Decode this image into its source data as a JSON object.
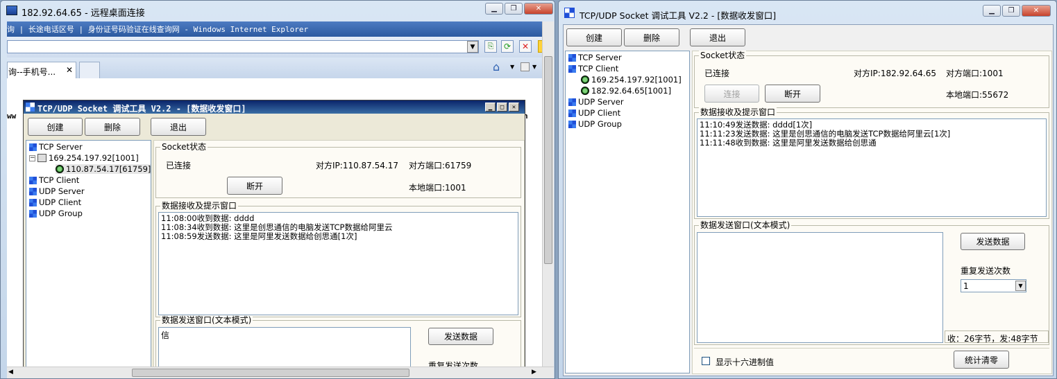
{
  "rdp": {
    "title": "182.92.64.65 - 远程桌面连接",
    "ie_title": "询 | 长途电话区号 | 身份证号码验证在线查询网 - Windows Internet Explorer",
    "ie_tab": "询--手机号...",
    "ie_url_fragment_left": "ww",
    "ie_url_fragment_right": "n"
  },
  "inner_tool": {
    "title": "TCP/UDP Socket 调试工具 V2.2 - [数据收发窗口]",
    "toolbar": {
      "create": "创建",
      "delete": "删除",
      "exit": "退出"
    },
    "tree": {
      "tcp_server": "TCP Server",
      "server_ip": "169.254.197.92[1001]",
      "client_conn": "110.87.54.17[61759]",
      "tcp_client": "TCP Client",
      "udp_server": "UDP Server",
      "udp_client": "UDP Client",
      "udp_group": "UDP Group"
    },
    "socket": {
      "group_label": "Socket状态",
      "status": "已连接",
      "remote_ip": "对方IP:110.87.54.17",
      "remote_port": "对方端口:61759",
      "local_port": "本地端口:1001",
      "disconnect": "断开"
    },
    "recv": {
      "group_label": "数据接收及提示窗口",
      "lines": [
        "11:08:00收到数据: dddd",
        "11:08:34收到数据: 这里是创思通信的电脑发送TCP数据给阿里云",
        "11:08:59发送数据: 这里是阿里发送数据给创思通[1次]"
      ]
    },
    "send": {
      "group_label": "数据发送窗口(文本模式)",
      "text": "信",
      "send_button": "发送数据",
      "repeat_label": "重复发送次数"
    }
  },
  "main_tool": {
    "title": "TCP/UDP Socket 调试工具 V2.2 - [数据收发窗口]",
    "toolbar": {
      "create": "创建",
      "delete": "删除",
      "exit": "退出"
    },
    "tree": {
      "tcp_server": "TCP Server",
      "tcp_client": "TCP Client",
      "client1": "169.254.197.92[1001]",
      "client2": "182.92.64.65[1001]",
      "udp_server": "UDP Server",
      "udp_client": "UDP Client",
      "udp_group": "UDP Group"
    },
    "socket": {
      "group_label": "Socket状态",
      "status": "已连接",
      "remote_ip": "对方IP:182.92.64.65",
      "remote_port": "对方端口:1001",
      "local_port": "本地端口:55672",
      "connect": "连接",
      "disconnect": "断开"
    },
    "recv": {
      "group_label": "数据接收及提示窗口",
      "lines": [
        "11:10:49发送数据: dddd[1次]",
        "11:11:23发送数据: 这里是创思通信的电脑发送TCP数据给阿里云[1次]",
        "11:11:48收到数据: 这里是阿里发送数据给创思通"
      ]
    },
    "send": {
      "group_label": "数据发送窗口(文本模式)",
      "send_button": "发送数据",
      "repeat_label": "重复发送次数",
      "repeat_value": "1",
      "stats": "收：26字节，发:48字节",
      "hex_label": "显示十六进制值",
      "clear_button": "统计清零"
    }
  }
}
